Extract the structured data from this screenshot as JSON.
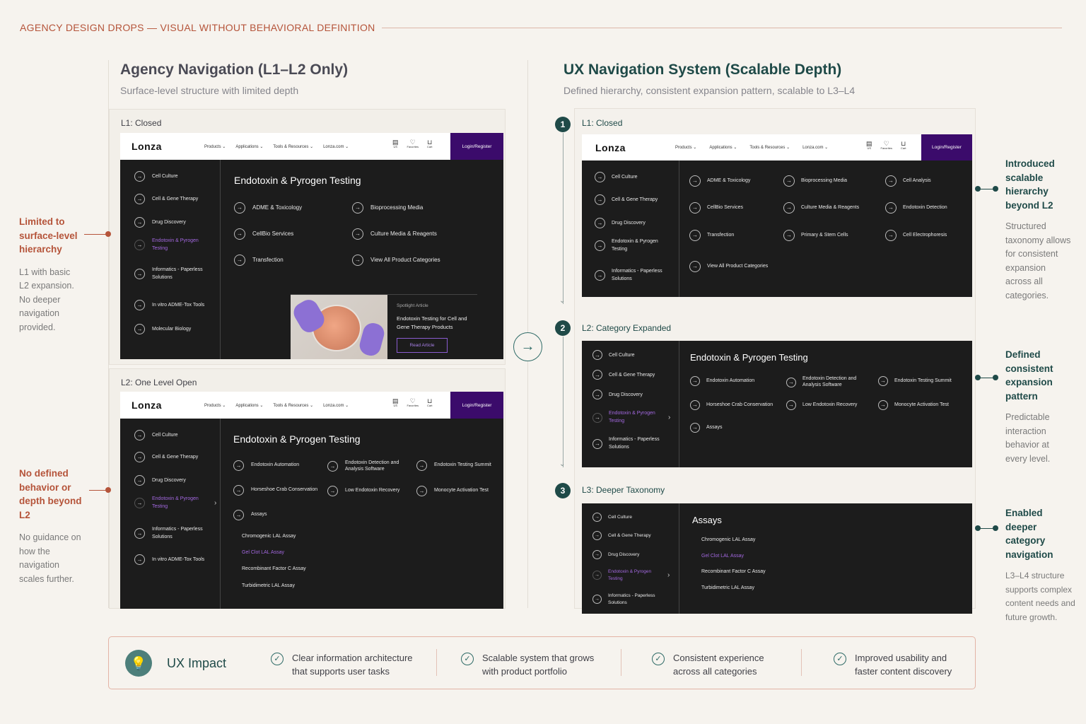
{
  "header": {
    "title": "AGENCY DESIGN DROPS — VISUAL WITHOUT BEHAVIORAL DEFINITION"
  },
  "colors": {
    "accent_red": "#b5543a",
    "accent_teal": "#1f4a48",
    "purple": "#3b0b6b",
    "highlight_purple": "#a368e0"
  },
  "site": {
    "logo": "Lonza",
    "menu": [
      "Products ⌄",
      "Applications ⌄",
      "Tools & Resources ⌄",
      "Lonza.com ⌄"
    ],
    "icons": {
      "flag": "US",
      "favorites": "Favorites",
      "cart": "Cart"
    },
    "login": "Login/Register"
  },
  "left": {
    "title": "Agency Navigation (L1–L2 Only)",
    "subtitle": "Surface-level structure with limited depth",
    "card1": {
      "label": "L1: Closed",
      "sidebar": [
        "Cell Culture",
        "Cell & Gene Therapy",
        "Drug Discovery",
        "Endotoxin & Pyrogen Testing",
        "Informatics - Paperless Solutions",
        "In vitro ADME-Tox Tools",
        "Molecular Biology"
      ],
      "panel_title": "Endotoxin & Pyrogen Testing",
      "items": [
        "ADME & Toxicology",
        "Bioprocessing Media",
        "CellBio Services",
        "Culture Media & Reagents",
        "Transfection",
        "View All Product Categories"
      ],
      "spotlight": {
        "kicker": "Spotlight Article",
        "title": "Endotoxin Testing for Cell and Gene Therapy Products",
        "button": "Read Article"
      }
    },
    "card2": {
      "label": "L2: One Level Open",
      "sidebar": [
        "Cell Culture",
        "Cell & Gene Therapy",
        "Drug Discovery",
        "Endotoxin & Pyrogen Testing",
        "Informatics - Paperless Solutions",
        "In vitro ADME-Tox Tools"
      ],
      "panel_title": "Endotoxin & Pyrogen Testing",
      "items": [
        "Endotoxin Automation",
        "Endotoxin Detection and Analysis Software",
        "Endotoxin Testing Summit",
        "Horseshoe Crab Conservation",
        "Low Endotoxin Recovery",
        "Monocyte Activation Test",
        "Assays"
      ],
      "subitems": [
        "Chromogenic LAL Assay",
        "Gel Clot LAL Assay",
        "Recombinant Factor C Assay",
        "Turbidimetric LAL Assay"
      ]
    },
    "callouts": [
      {
        "title": "Limited to surface-level hierarchy",
        "body": "L1 with basic L2 expansion. No deeper navigation provided."
      },
      {
        "title": "No defined behavior or depth beyond L2",
        "body": "No guidance on how the navigation scales further."
      }
    ]
  },
  "right": {
    "title": "UX Navigation System (Scalable Depth)",
    "subtitle": "Defined hierarchy, consistent expansion pattern, scalable to L3–L4",
    "step1": {
      "num": "1",
      "label": "L1: Closed",
      "sidebar": [
        "Cell Culture",
        "Cell & Gene Therapy",
        "Drug Discovery",
        "Endotoxin & Pyrogen Testing",
        "Informatics - Paperless Solutions"
      ],
      "items": [
        "ADME & Toxicology",
        "Bioprocessing Media",
        "Cell Analysis",
        "CellBio Services",
        "Culture Media & Reagents",
        "Endotoxin Detection",
        "Transfection",
        "Primary & Stem Cells",
        "Cell Electrophoresis",
        "View All Product Categories"
      ]
    },
    "step2": {
      "num": "2",
      "label": "L2: Category Expanded",
      "sidebar": [
        "Cell Culture",
        "Cell & Gene Therapy",
        "Drug Discovery",
        "Endotoxin & Pyrogen Testing",
        "Informatics - Paperless Solutions"
      ],
      "panel_title": "Endotoxin & Pyrogen Testing",
      "items": [
        "Endotoxin Automation",
        "Endotoxin Detection and Analysis Software",
        "Endotoxin Testing Summit",
        "Horseshoe Crab Conservation",
        "Low Endotoxin Recovery",
        "Monocyte Activation Test",
        "Assays"
      ]
    },
    "step3": {
      "num": "3",
      "label": "L3: Deeper Taxonomy",
      "sidebar": [
        "Cell Culture",
        "Cell & Gene Therapy",
        "Drug Discovery",
        "Endotoxin & Pyrogen Testing",
        "Informatics - Paperless Solutions"
      ],
      "panel_title": "Assays",
      "subitems": [
        "Chromogenic LAL Assay",
        "Gel Clot LAL Assay",
        "Recombinant Factor C Assay",
        "Turbidimetric LAL Assay"
      ]
    },
    "callouts": [
      {
        "title": "Introduced scalable hierarchy beyond L2",
        "body": "Structured taxonomy allows for consistent expansion across all categories."
      },
      {
        "title": "Defined consistent expansion pattern",
        "body": "Predictable interaction behavior at every level."
      },
      {
        "title": "Enabled deeper category navigation",
        "body": "L3–L4 structure supports complex content needs and future growth."
      }
    ]
  },
  "impact": {
    "title": "UX Impact",
    "items": [
      {
        "line1": "Clear information architecture",
        "line2": "that supports user tasks"
      },
      {
        "line1": "Scalable system that grows",
        "line2": "with product portfolio"
      },
      {
        "line1": "Consistent experience",
        "line2": "across all categories"
      },
      {
        "line1": "Improved usability and",
        "line2": "faster content discovery"
      }
    ]
  }
}
